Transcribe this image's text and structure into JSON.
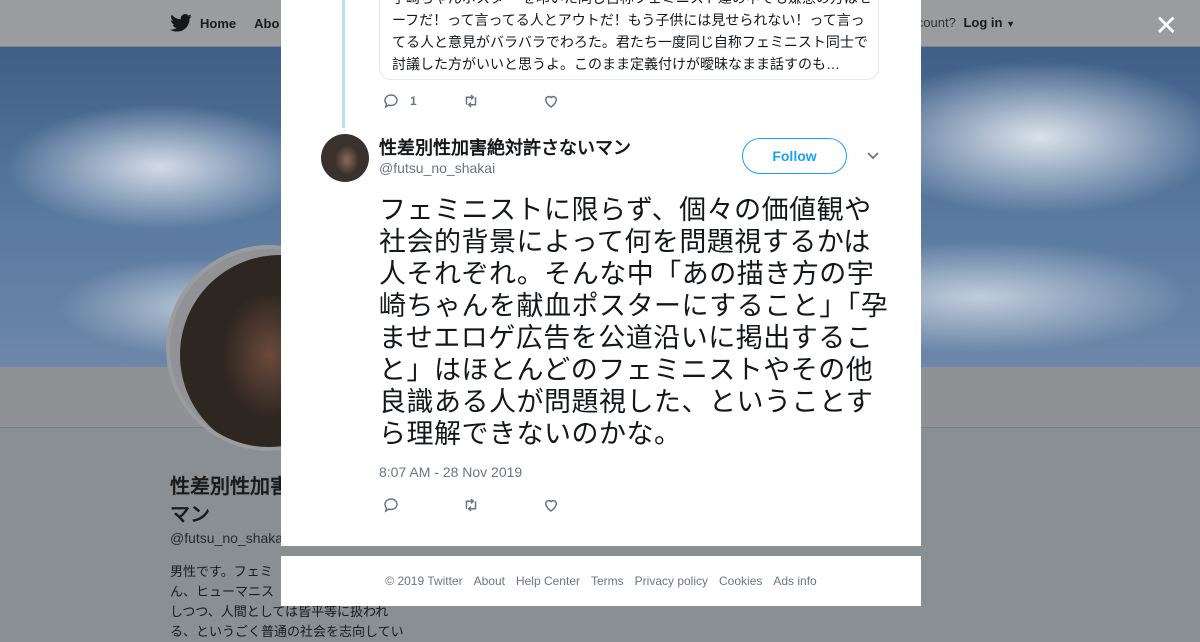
{
  "background": {
    "nav": {
      "home_label": "Home",
      "about_label": "Abo",
      "account_prompt": "count?",
      "login_label": "Log in"
    },
    "profile": {
      "name": "性差別性加害",
      "name_line2": "マン",
      "handle": "@futsu_no_shaka",
      "bio_lines": [
        "男性です。フェミ",
        "ん、ヒューマニス",
        "しつつ、人間としては皆平等に扱われ",
        "る、というごく普通の社会を志向してい"
      ]
    },
    "close_icon": "close-icon"
  },
  "modal": {
    "quoted_lines": [
      "子崎ちゃんポスター を叩いた同じ自称フェミニスト達の中でも嫌悪の方はセ",
      "ーフだ！って言ってる人とアウトだ！もう子供には見せられない！って言っ",
      "てる人と意見がバラバラでわろた。君たち一度同じ自称フェミニスト同士で",
      "討議した方がいいと思うよ。このまま定義付けが曖昧なまま話すのも…"
    ],
    "parent_actions": {
      "reply_count": "1"
    },
    "tweet": {
      "author_name": "性差別性加害絶対許さないマン",
      "author_handle": "@futsu_no_shakai",
      "follow_label": "Follow",
      "text": "フェミニストに限らず、個々の価値観や社会的背景によって何を問題視するかは人それぞれ。そんな中「あの描き方の宇崎ちゃんを献血ポスターにすること」「孕ませエロゲ広告を公道沿いに掲出すること」はほとんどのフェミニストやその他良識ある人が問題視した、ということすら理解できないのかな。",
      "timestamp": "8:07 AM - 28 Nov 2019"
    }
  },
  "footer": {
    "links": [
      "© 2019 Twitter",
      "About",
      "Help Center",
      "Terms",
      "Privacy policy",
      "Cookies",
      "Ads info"
    ]
  },
  "colors": {
    "accent": "#1da1f2",
    "muted": "#657786",
    "text": "#14171a"
  }
}
